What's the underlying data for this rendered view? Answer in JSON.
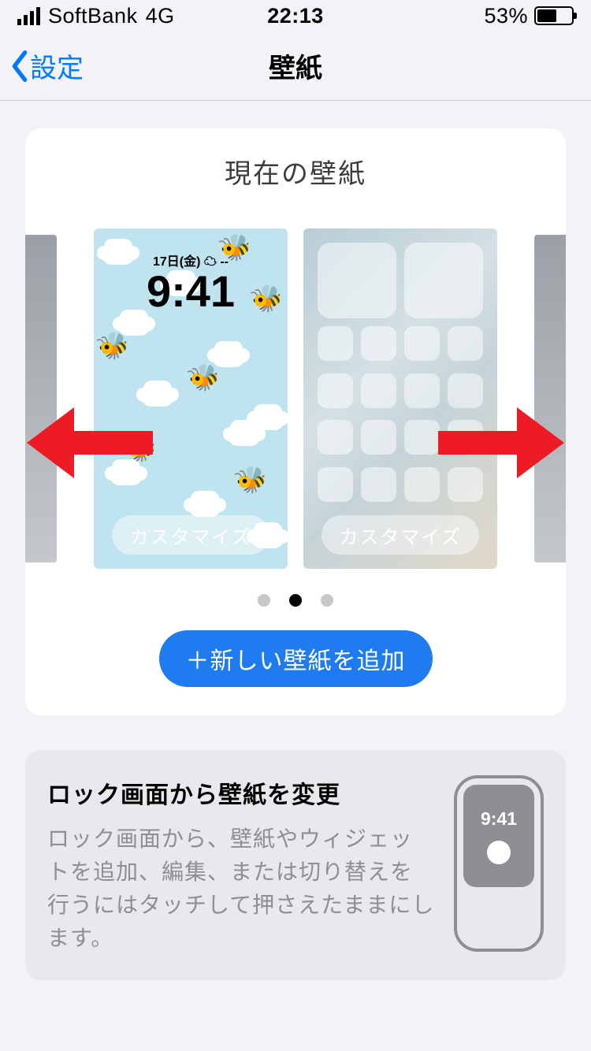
{
  "status": {
    "carrier": "SoftBank",
    "network": "4G",
    "time": "22:13",
    "battery_pct": "53%"
  },
  "nav": {
    "back_label": "設定",
    "title": "壁紙"
  },
  "section": {
    "heading": "現在の壁紙"
  },
  "wallpapers": {
    "lock": {
      "date_line": "17日(金) ☁ --",
      "clock": "9:41",
      "customize": "カスタマイズ"
    },
    "home": {
      "customize": "カスタマイズ"
    }
  },
  "pager": {
    "count": 3,
    "active_index": 1
  },
  "add_button": "＋新しい壁紙を追加",
  "tip": {
    "title": "ロック画面から壁紙を変更",
    "body": "ロック画面から、壁紙やウィジェットを追加、編集、または切り替えを行うにはタッチして押さえたままにします。",
    "mini_time": "9:41"
  }
}
